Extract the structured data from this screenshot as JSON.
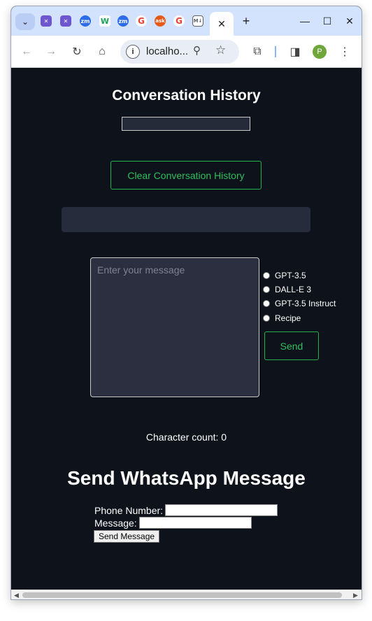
{
  "browser": {
    "tabs": [
      {
        "icon": "search-tabs-icon",
        "label": "⌄"
      },
      {
        "icon": "tools-icon",
        "label": "✕",
        "color": "#6e56cf"
      },
      {
        "icon": "tools-icon",
        "label": "✕",
        "color": "#6e56cf"
      },
      {
        "icon": "zoom-icon",
        "label": "zm",
        "color": "#2d6ce8"
      },
      {
        "icon": "w-icon",
        "label": "W",
        "color": "#1aa35c"
      },
      {
        "icon": "zoom-icon",
        "label": "zm",
        "color": "#2d6ce8"
      },
      {
        "icon": "google-icon",
        "label": "G",
        "color": "#ea4335"
      },
      {
        "icon": "ask-icon",
        "label": "ask",
        "color": "#e55a1a"
      },
      {
        "icon": "google-icon",
        "label": "G",
        "color": "#ea4335"
      },
      {
        "icon": "markdown-icon",
        "label": "M↓",
        "color": "#5f6368"
      }
    ],
    "active_tab_close": "✕",
    "new_tab": "+",
    "url": "localho...",
    "avatar_initial": "P"
  },
  "conversation": {
    "title": "Conversation History",
    "clear_button": "Clear Conversation History"
  },
  "composer": {
    "placeholder": "Enter your message",
    "models": [
      "GPT-3.5",
      "DALL-E 3",
      "GPT-3.5 Instruct",
      "Recipe"
    ],
    "send_button": "Send",
    "char_count": "Character count: 0"
  },
  "whatsapp": {
    "title": "Send WhatsApp Message",
    "phone_label": "Phone Number:",
    "message_label": "Message:",
    "send_button": "Send Message"
  },
  "colors": {
    "page_bg": "#0d121b",
    "accent_green": "#22b14c",
    "panel": "#272c3c"
  }
}
